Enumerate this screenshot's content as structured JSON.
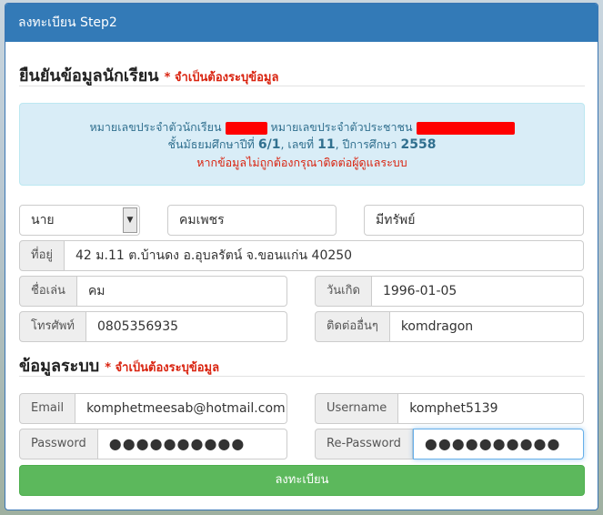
{
  "header": {
    "title": "ลงทะเบียน Step2"
  },
  "student_section": {
    "title": "ยืนยันข้อมูลนักเรียน",
    "required_note": "* จำเป็นต้องระบุข้อมูล"
  },
  "info": {
    "student_id_label": "หมายเลขประจำตัวนักเรียน",
    "citizen_id_label": "หมายเลขประจำตัวประชาชน",
    "class_prefix": "ชั้นมัธยมศึกษาปีที่",
    "class_value": "6/1",
    "number_prefix": ", เลขที่",
    "number_value": "11",
    "year_prefix": ", ปีการศึกษา",
    "year_value": "2558",
    "warning": "หากข้อมูลไม่ถูกต้องกรุณาติดต่อผู้ดูแลระบบ"
  },
  "form": {
    "title_select": "นาย",
    "first_name": "คมเพชร",
    "last_name": "มีทรัพย์",
    "address_label": "ที่อยู่",
    "address": "42 ม.11 ต.บ้านดง อ.อุบลรัตน์ จ.ขอนแก่น 40250",
    "nickname_label": "ชื่อเล่น",
    "nickname": "คม",
    "birthday_label": "วันเกิด",
    "birthday": "1996-01-05",
    "phone_label": "โทรศัพท์",
    "phone": "0805356935",
    "other_contact_label": "ติดต่ออื่นๆ",
    "other_contact": "komdragon"
  },
  "system_section": {
    "title": "ข้อมูลระบบ",
    "required_note": "* จำเป็นต้องระบุข้อมูล"
  },
  "system": {
    "email_label": "Email",
    "email": "komphetmeesab@hotmail.com",
    "username_label": "Username",
    "username": "komphet5139",
    "password_label": "Password",
    "password": "●●●●●●●●●●",
    "repassword_label": "Re-Password",
    "repassword": "●●●●●●●●●●"
  },
  "submit_label": "ลงทะเบียน",
  "colors": {
    "primary": "#337ab7",
    "success": "#5cb85c",
    "danger": "#d9230f",
    "info_bg": "#d9edf7"
  }
}
